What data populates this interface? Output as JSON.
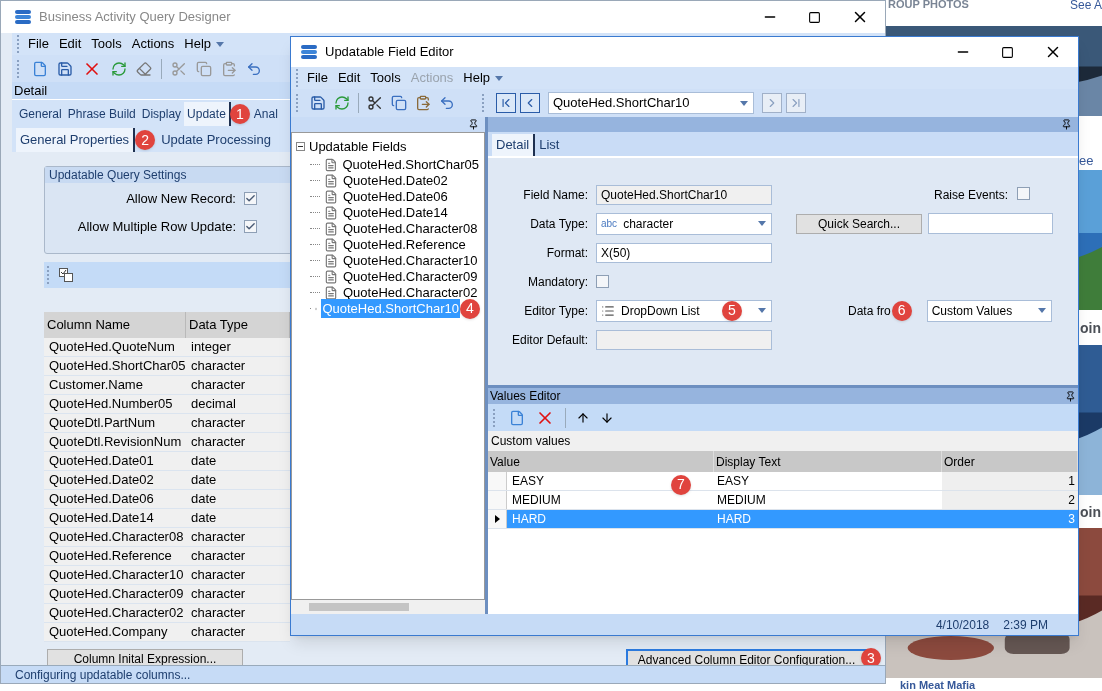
{
  "main_window": {
    "title": "Business Activity Query Designer",
    "menu": [
      "File",
      "Edit",
      "Tools",
      "Actions",
      "Help"
    ],
    "section_label": "Detail",
    "tabs": [
      {
        "label": "General",
        "selected": false
      },
      {
        "label": "Phrase Build",
        "selected": false
      },
      {
        "label": "Display",
        "selected": false
      },
      {
        "label": "Update",
        "selected": true,
        "badge": "1"
      },
      {
        "label": "Anal",
        "selected": false
      }
    ],
    "subtabs": [
      {
        "label": "General Properties",
        "selected": true,
        "badge": "2"
      },
      {
        "label": "Update Processing",
        "selected": false
      }
    ],
    "settings_group": {
      "title": "Updatable Query Settings",
      "options": [
        {
          "label": "Allow New Record:",
          "checked": true
        },
        {
          "label": "Allow Multiple Row Update:",
          "checked": true
        }
      ]
    },
    "columns_table": {
      "columns": [
        "Column Name",
        "Data Type"
      ],
      "rows": [
        [
          "QuoteHed.QuoteNum",
          "integer"
        ],
        [
          "QuoteHed.ShortChar05",
          "character"
        ],
        [
          "Customer.Name",
          "character"
        ],
        [
          "QuoteHed.Number05",
          "decimal"
        ],
        [
          "QuoteDtl.PartNum",
          "character"
        ],
        [
          "QuoteDtl.RevisionNum",
          "character"
        ],
        [
          "QuoteHed.Date01",
          "date"
        ],
        [
          "QuoteHed.Date02",
          "date"
        ],
        [
          "QuoteHed.Date06",
          "date"
        ],
        [
          "QuoteHed.Date14",
          "date"
        ],
        [
          "QuoteHed.Character08",
          "character"
        ],
        [
          "QuoteHed.Reference",
          "character"
        ],
        [
          "QuoteHed.Character10",
          "character"
        ],
        [
          "QuoteHed.Character09",
          "character"
        ],
        [
          "QuoteHed.Character02",
          "character"
        ],
        [
          "QuoteHed.Company",
          "character"
        ]
      ]
    },
    "buttons": [
      {
        "label": "Column Inital Expression..."
      },
      {
        "label": "Advanced Column Editor Configuration...",
        "badge": "3"
      }
    ],
    "status_bar": "Configuring updatable columns..."
  },
  "editor_window": {
    "title": "Updatable Field Editor",
    "menu": [
      {
        "label": "File",
        "disabled": false
      },
      {
        "label": "Edit",
        "disabled": false
      },
      {
        "label": "Tools",
        "disabled": false
      },
      {
        "label": "Actions",
        "disabled": true
      },
      {
        "label": "Help",
        "disabled": false
      }
    ],
    "record_selector": "QuoteHed.ShortChar10",
    "tree": {
      "label": "Updatable Fields",
      "expanded": true,
      "children": [
        {
          "label": "QuoteHed.ShortChar05",
          "selected": false
        },
        {
          "label": "QuoteHed.Date02",
          "selected": false
        },
        {
          "label": "QuoteHed.Date06",
          "selected": false
        },
        {
          "label": "QuoteHed.Date14",
          "selected": false
        },
        {
          "label": "QuoteHed.Character08",
          "selected": false
        },
        {
          "label": "QuoteHed.Reference",
          "selected": false
        },
        {
          "label": "QuoteHed.Character10",
          "selected": false
        },
        {
          "label": "QuoteHed.Character09",
          "selected": false
        },
        {
          "label": "QuoteHed.Character02",
          "selected": false
        },
        {
          "label": "QuoteHed.ShortChar10",
          "selected": true,
          "badge": "4"
        }
      ]
    },
    "tabs": [
      {
        "label": "Detail",
        "selected": true
      },
      {
        "label": "List",
        "selected": false
      }
    ],
    "form": {
      "field_name": {
        "label": "Field Name:",
        "value": "QuoteHed.ShortChar10"
      },
      "data_type": {
        "label": "Data Type:",
        "prefix": "abc",
        "value": "character"
      },
      "format": {
        "label": "Format:",
        "value": "X(50)"
      },
      "mandatory": {
        "label": "Mandatory:",
        "checked": false
      },
      "editor_type": {
        "label": "Editor Type:",
        "value": "DropDown List",
        "badge": "5"
      },
      "editor_default": {
        "label": "Editor Default:"
      },
      "raise_events": {
        "label": "Raise Events:",
        "checked": false
      },
      "quick_search": {
        "label": "Quick Search..."
      },
      "data_from": {
        "label": "Data fro",
        "value": "Custom Values",
        "badge": "6"
      }
    },
    "values_editor": {
      "title": "Values Editor",
      "caption": "Custom values",
      "columns": [
        "Value",
        "Display Text",
        "Order"
      ],
      "badge": "7",
      "rows": [
        {
          "value": "EASY",
          "display": "EASY",
          "order": "1",
          "selected": false
        },
        {
          "value": "MEDIUM",
          "display": "MEDIUM",
          "order": "2",
          "selected": false
        },
        {
          "value": "HARD",
          "display": "HARD",
          "order": "3",
          "selected": true
        }
      ]
    },
    "status_bar": {
      "date": "4/10/2018",
      "time": "2:39 PM"
    }
  },
  "background_page": {
    "texts": [
      "ROUP PHOTOS",
      "See A",
      "ee",
      "oin",
      "oin",
      "kin Meat Mafia"
    ]
  }
}
